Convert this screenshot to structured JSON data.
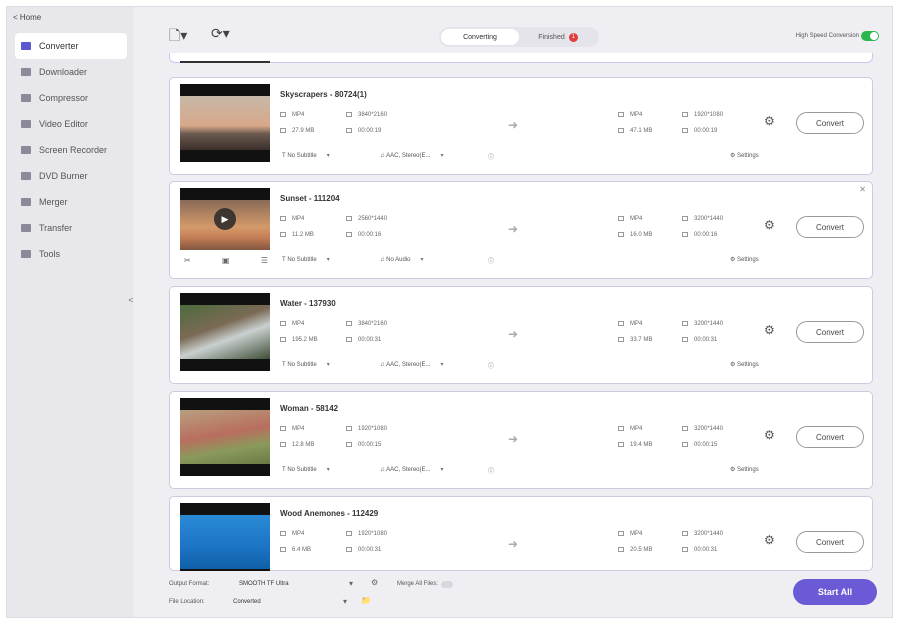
{
  "home": "< Home",
  "sidebar": {
    "items": [
      {
        "label": "Converter",
        "active": true
      },
      {
        "label": "Downloader",
        "active": false
      },
      {
        "label": "Compressor",
        "active": false
      },
      {
        "label": "Video Editor",
        "active": false
      },
      {
        "label": "Screen Recorder",
        "active": false
      },
      {
        "label": "DVD Burner",
        "active": false
      },
      {
        "label": "Merger",
        "active": false
      },
      {
        "label": "Transfer",
        "active": false
      },
      {
        "label": "Tools",
        "active": false
      }
    ],
    "collapse": "<"
  },
  "topbar": {
    "tabs": [
      {
        "label": "Converting",
        "active": true
      },
      {
        "label": "Finished",
        "active": false
      }
    ],
    "finished_badge": "1",
    "high_speed_label": "High Speed Conversion",
    "accent_color": "#2db64f"
  },
  "files": [
    {
      "title": "Skyscrapers - 80724(1)",
      "src": {
        "format": "MP4",
        "resolution": "3840*2160",
        "size": "27.9 MB",
        "duration": "00:00:19"
      },
      "dst": {
        "format": "MP4",
        "resolution": "1920*1080",
        "size": "47.1 MB",
        "duration": "00:00:19"
      },
      "subtitle": "No Subtitle",
      "audio": "AAC, Stereo(E...",
      "settings": "Settings",
      "convert": "Convert"
    },
    {
      "title": "Sunset - 111204",
      "src": {
        "format": "MP4",
        "resolution": "2560*1440",
        "size": "11.2 MB",
        "duration": "00:00:16"
      },
      "dst": {
        "format": "MP4",
        "resolution": "3200*1440",
        "size": "16.0 MB",
        "duration": "00:00:16"
      },
      "subtitle": "No Subtitle",
      "audio": "No Audio",
      "settings": "Settings",
      "convert": "Convert"
    },
    {
      "title": "Water - 137930",
      "src": {
        "format": "MP4",
        "resolution": "3840*2160",
        "size": "195.2 MB",
        "duration": "00:00:31"
      },
      "dst": {
        "format": "MP4",
        "resolution": "3200*1440",
        "size": "33.7 MB",
        "duration": "00:00:31"
      },
      "subtitle": "No Subtitle",
      "audio": "AAC, Stereo(E...",
      "settings": "Settings",
      "convert": "Convert"
    },
    {
      "title": "Woman - 58142",
      "src": {
        "format": "MP4",
        "resolution": "1920*1080",
        "size": "12.8 MB",
        "duration": "00:00:15"
      },
      "dst": {
        "format": "MP4",
        "resolution": "3200*1440",
        "size": "19.4 MB",
        "duration": "00:00:15"
      },
      "subtitle": "No Subtitle",
      "audio": "AAC, Stereo(E...",
      "settings": "Settings",
      "convert": "Convert"
    },
    {
      "title": "Wood Anemones - 112429",
      "src": {
        "format": "MP4",
        "resolution": "1920*1080",
        "size": "6.4 MB",
        "duration": "00:00:31"
      },
      "dst": {
        "format": "MP4",
        "resolution": "3200*1440",
        "size": "20.5 MB",
        "duration": "00:00:31"
      },
      "subtitle": "No Subtitle",
      "audio": "AAC, Stereo(E...",
      "settings": "Settings",
      "convert": "Convert"
    }
  ],
  "bottom": {
    "output_format_label": "Output Format:",
    "output_format_value": "SMOOTH TF Ultra",
    "merge_label": "Merge All Files:",
    "file_location_label": "File Location:",
    "file_location_value": "Converted",
    "start_all": "Start All",
    "start_color": "#6a5ad6"
  }
}
